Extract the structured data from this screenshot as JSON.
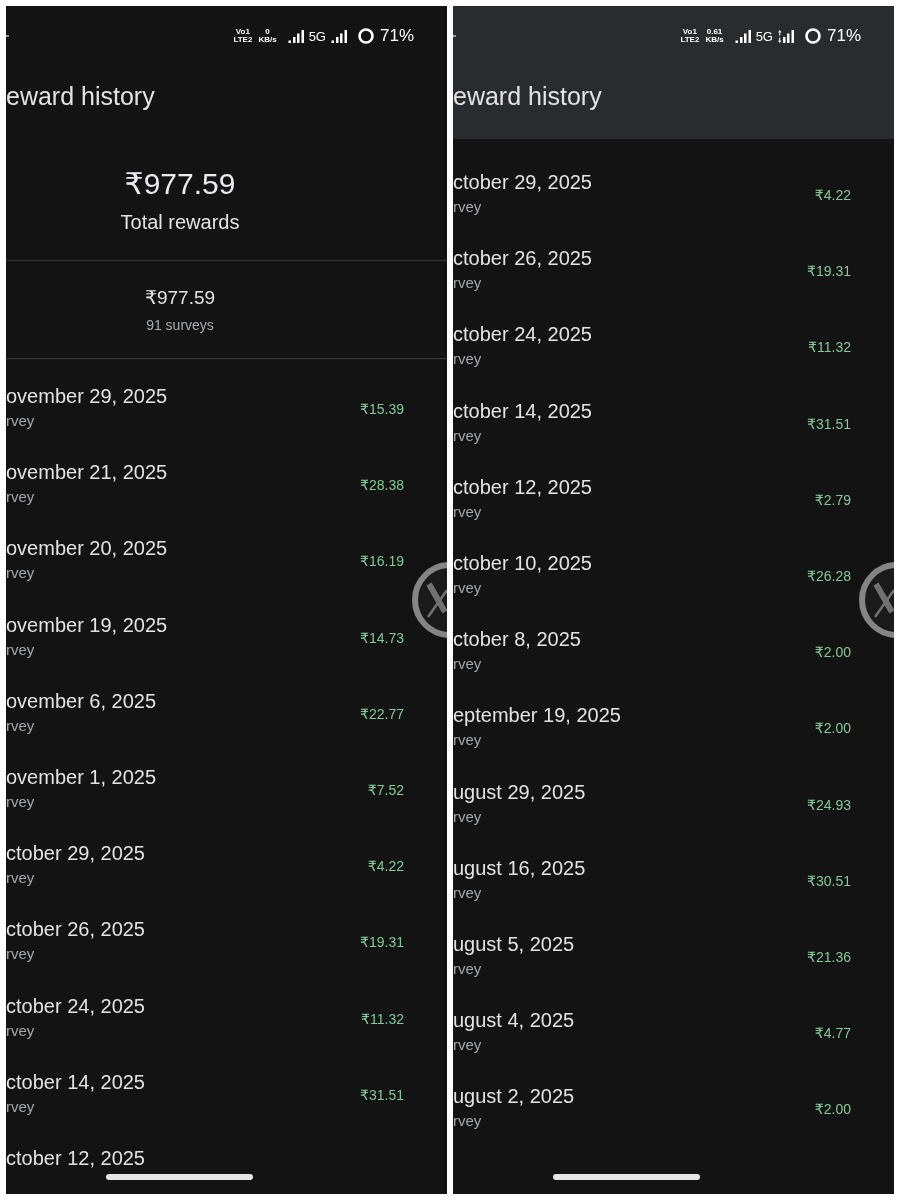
{
  "panels": [
    {
      "status_bar": {
        "network_top": "Vo1",
        "network_bottom": "LTE2",
        "speed_value": "0",
        "speed_unit": "KB/s",
        "network": "5G",
        "data_active": false,
        "battery": "71%"
      },
      "header": {
        "title": "eward history",
        "elevated": false
      },
      "summary": {
        "total_amount": "₹977.59",
        "total_label": "Total rewards",
        "sub_amount": "₹977.59",
        "survey_count": "91 surveys"
      },
      "rewards": [
        {
          "date": "ovember 29, 2025",
          "type": "rvey",
          "amount": "₹15.39"
        },
        {
          "date": "ovember 21, 2025",
          "type": "rvey",
          "amount": "₹28.38"
        },
        {
          "date": "ovember 20, 2025",
          "type": "rvey",
          "amount": "₹16.19"
        },
        {
          "date": "ovember 19, 2025",
          "type": "rvey",
          "amount": "₹14.73"
        },
        {
          "date": "ovember 6, 2025",
          "type": "rvey",
          "amount": "₹22.77"
        },
        {
          "date": "ovember 1, 2025",
          "type": "rvey",
          "amount": "₹7.52"
        },
        {
          "date": "ctober 29, 2025",
          "type": "rvey",
          "amount": "₹4.22"
        },
        {
          "date": "ctober 26, 2025",
          "type": "rvey",
          "amount": "₹19.31"
        },
        {
          "date": "ctober 24, 2025",
          "type": "rvey",
          "amount": "₹11.32"
        },
        {
          "date": "ctober 14, 2025",
          "type": "rvey",
          "amount": "₹31.51"
        },
        {
          "date": "ctober 12, 2025"
        }
      ]
    },
    {
      "status_bar": {
        "network_top": "Vo1",
        "network_bottom": "LTE2",
        "speed_value": "0.61",
        "speed_unit": "KB/s",
        "network": "5G",
        "data_active": true,
        "battery": "71%"
      },
      "header": {
        "title": "eward history",
        "elevated": true
      },
      "rewards": [
        {
          "date": "ctober 29, 2025",
          "type": "rvey",
          "amount": "₹4.22"
        },
        {
          "date": "ctober 26, 2025",
          "type": "rvey",
          "amount": "₹19.31"
        },
        {
          "date": "ctober 24, 2025",
          "type": "rvey",
          "amount": "₹11.32"
        },
        {
          "date": "ctober 14, 2025",
          "type": "rvey",
          "amount": "₹31.51"
        },
        {
          "date": "ctober 12, 2025",
          "type": "rvey",
          "amount": "₹2.79"
        },
        {
          "date": "ctober 10, 2025",
          "type": "rvey",
          "amount": "₹26.28"
        },
        {
          "date": "ctober 8, 2025",
          "type": "rvey",
          "amount": "₹2.00"
        },
        {
          "date": "eptember 19, 2025",
          "type": "rvey",
          "amount": "₹2.00"
        },
        {
          "date": "ugust 29, 2025",
          "type": "rvey",
          "amount": "₹24.93"
        },
        {
          "date": "ugust 16, 2025",
          "type": "rvey",
          "amount": "₹30.51"
        },
        {
          "date": "ugust 5, 2025",
          "type": "rvey",
          "amount": "₹21.36"
        },
        {
          "date": "ugust 4, 2025",
          "type": "rvey",
          "amount": "₹4.77"
        },
        {
          "date": "ugust 2, 2025",
          "type": "rvey",
          "amount": "₹2.00"
        }
      ]
    }
  ]
}
